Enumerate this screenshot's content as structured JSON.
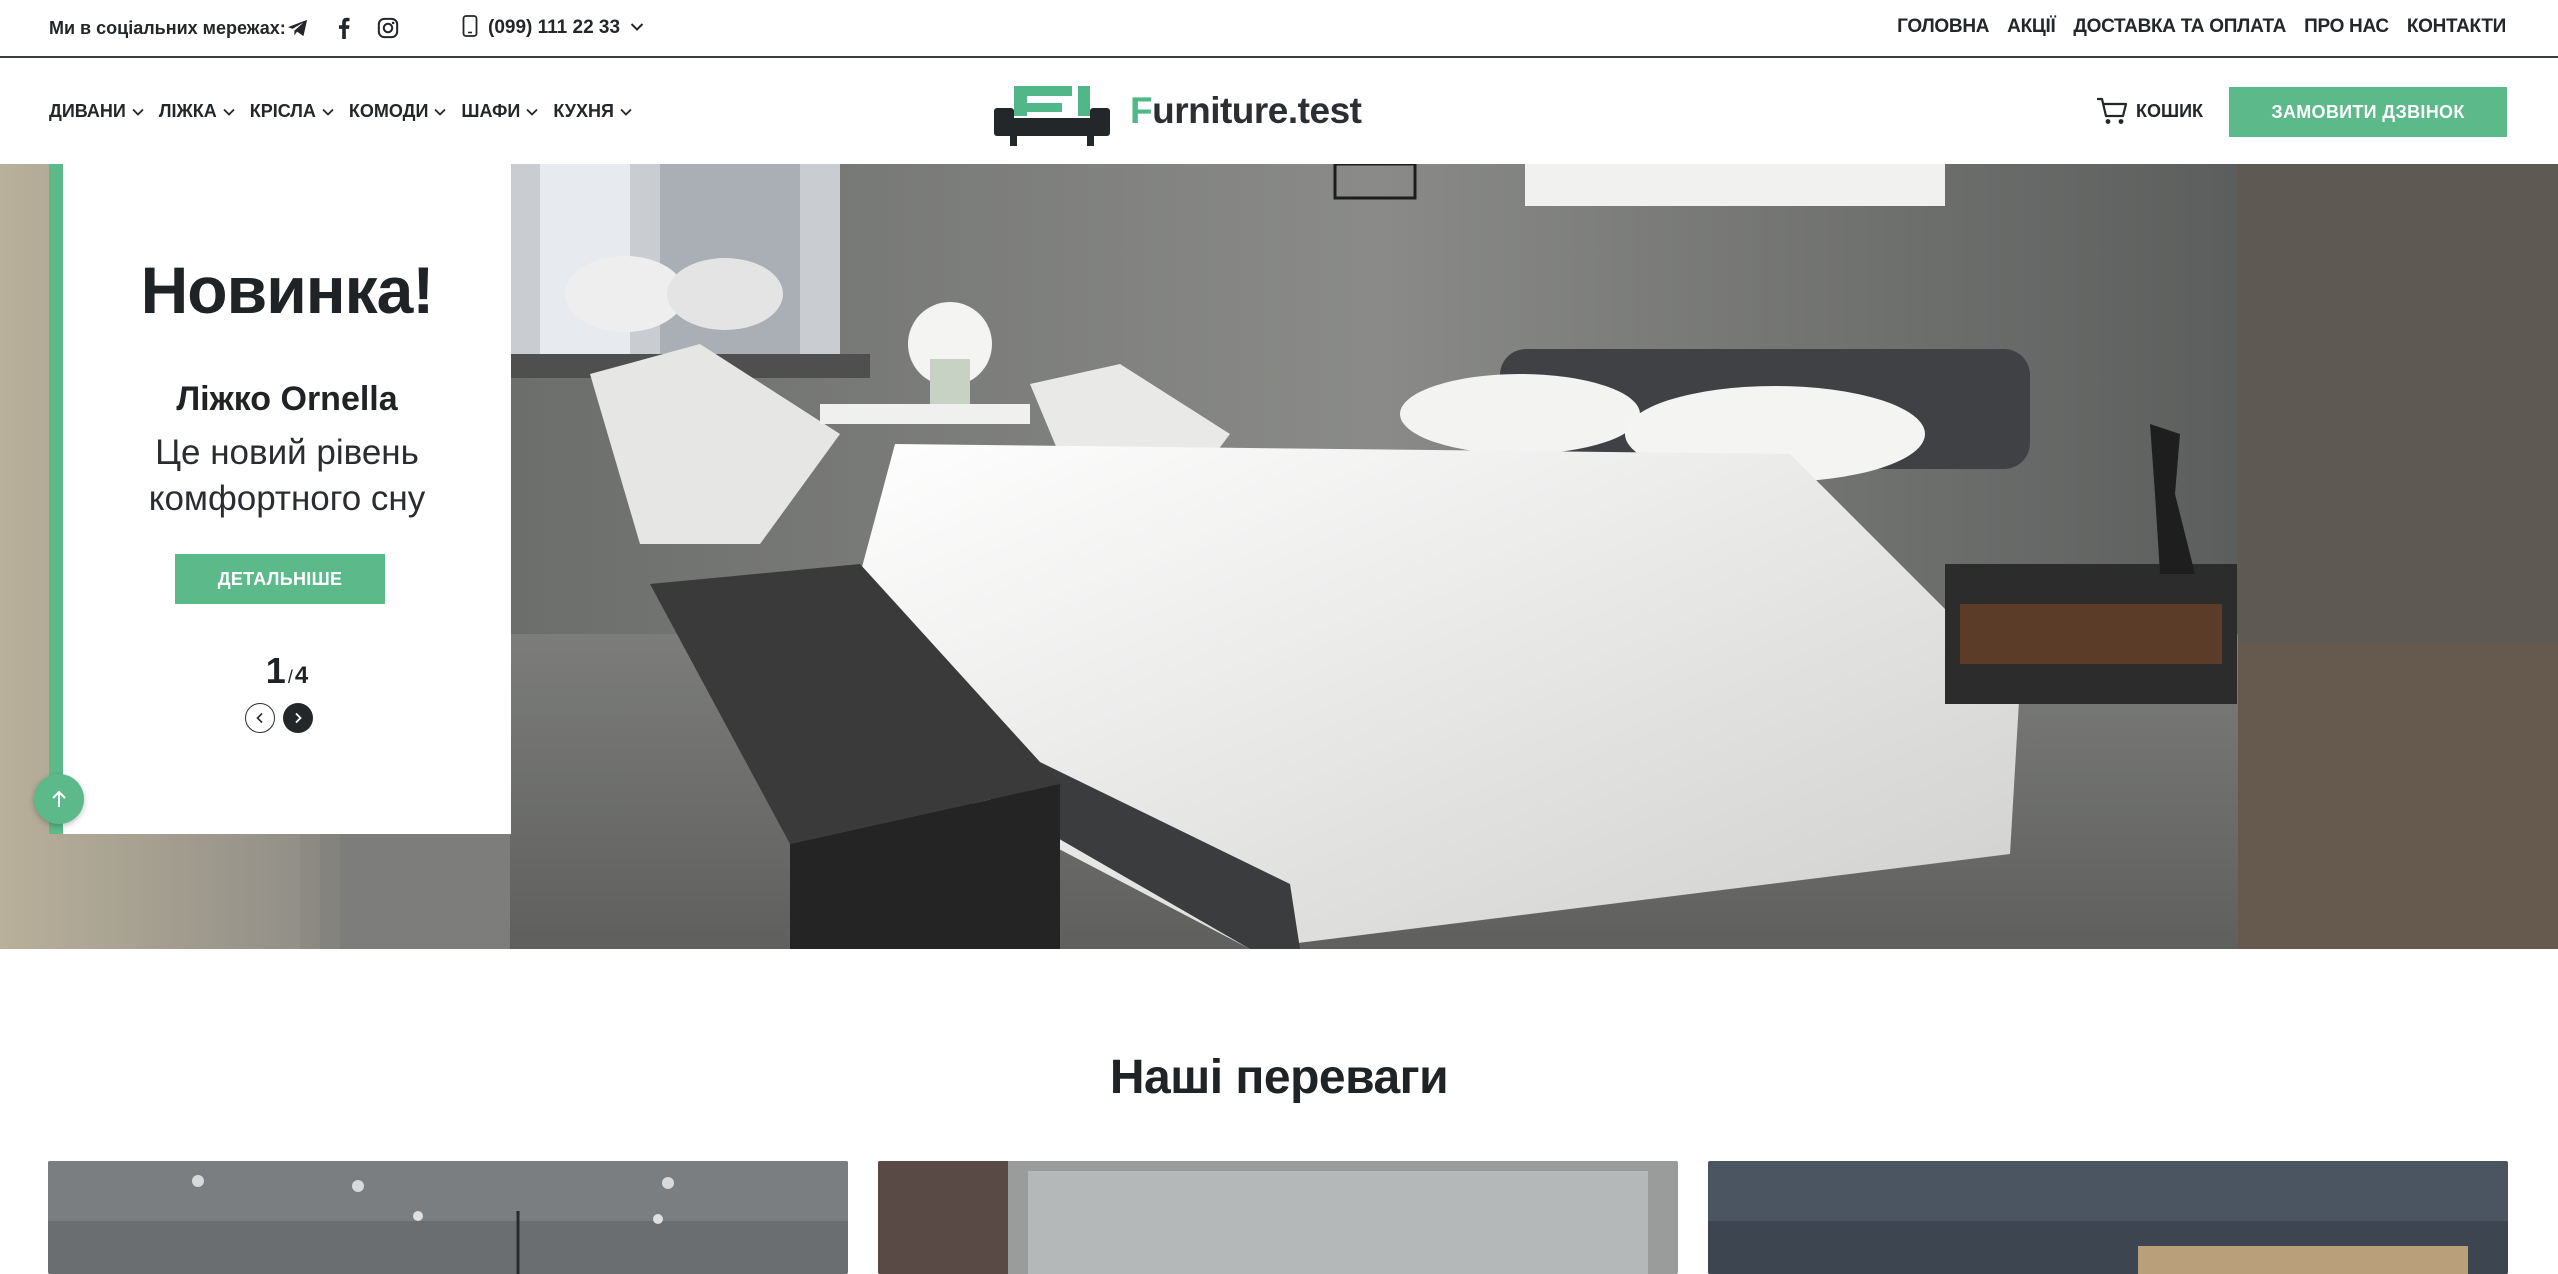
{
  "topbar": {
    "social_label": "Ми в соціальних мережах:",
    "social_icons": [
      "telegram-icon",
      "facebook-icon",
      "instagram-icon"
    ],
    "phone": "(099) 111 22 33",
    "nav": [
      "ГОЛОВНА",
      "АКЦІЇ",
      "ДОСТАВКА ТА ОПЛАТА",
      "ПРО НАС",
      "КОНТАКТИ"
    ]
  },
  "header": {
    "categories": [
      "ДИВАНИ",
      "ЛІЖКА",
      "КРІСЛА",
      "КОМОДИ",
      "ШАФИ",
      "КУХНЯ"
    ],
    "logo_first_letter": "F",
    "logo_rest": "urniture.test",
    "cart_label": "КОШИК",
    "call_button": "ЗАМОВИТИ ДЗВІНОК"
  },
  "hero": {
    "badge": "Новинка!",
    "title": "Ліжко Ornella",
    "description": "Це новий рівень комфортного сну",
    "button": "ДЕТАЛЬНІШЕ",
    "current_slide": "1",
    "separator": "/",
    "total_slides": "4"
  },
  "advantages": {
    "title": "Наші переваги"
  },
  "colors": {
    "accent": "#5bb98a",
    "text_dark": "#1f2326"
  }
}
